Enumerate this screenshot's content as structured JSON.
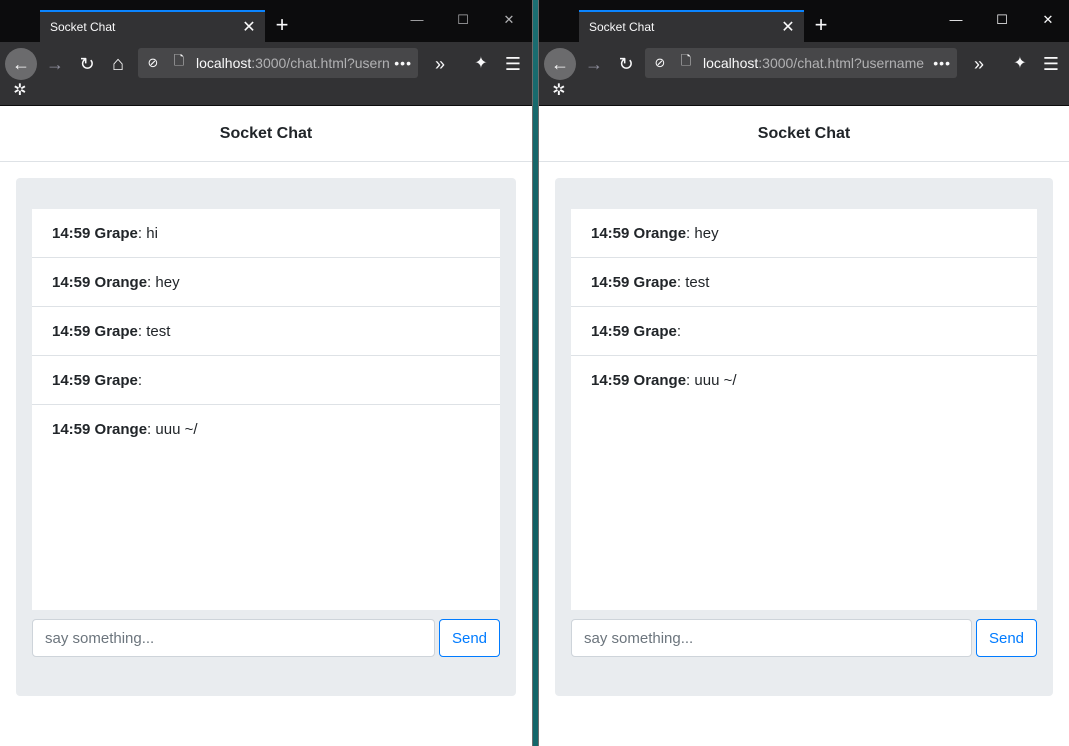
{
  "windows": [
    {
      "tab_title": "Socket Chat",
      "url_host": "localhost",
      "url_rest": ":3000/chat.html?usern",
      "page_title": "Socket Chat",
      "input_placeholder": "say something...",
      "send_label": "Send",
      "messages": [
        {
          "meta": "14:59 Grape",
          "text": ": hi"
        },
        {
          "meta": "14:59 Orange",
          "text": ": hey"
        },
        {
          "meta": "14:59 Grape",
          "text": ": test"
        },
        {
          "meta": "14:59 Grape",
          "text": ":"
        },
        {
          "meta": "14:59 Orange",
          "text": ": uuu ~/"
        }
      ]
    },
    {
      "tab_title": "Socket Chat",
      "url_host": "localhost",
      "url_rest": ":3000/chat.html?username",
      "page_title": "Socket Chat",
      "input_placeholder": "say something...",
      "send_label": "Send",
      "messages": [
        {
          "meta": "14:59 Orange",
          "text": ": hey"
        },
        {
          "meta": "14:59 Grape",
          "text": ": test"
        },
        {
          "meta": "14:59 Grape",
          "text": ":"
        },
        {
          "meta": "14:59 Orange",
          "text": ": uuu ~/"
        }
      ]
    }
  ],
  "icons": {
    "close": "✕",
    "new_tab": "+",
    "minimize": "—",
    "maximize": "☐",
    "window_close": "✕",
    "back": "←",
    "forward": "→",
    "reload": "↻",
    "home": "⌂",
    "tracking": "⊘",
    "page": "🗋",
    "more": "•••",
    "overflow": "»",
    "extension": "✦",
    "menu": "☰",
    "settings": "✲"
  },
  "colors": {
    "accent": "#007bff",
    "tab_highlight": "#0a84ff",
    "card_bg": "#e9ecef"
  }
}
